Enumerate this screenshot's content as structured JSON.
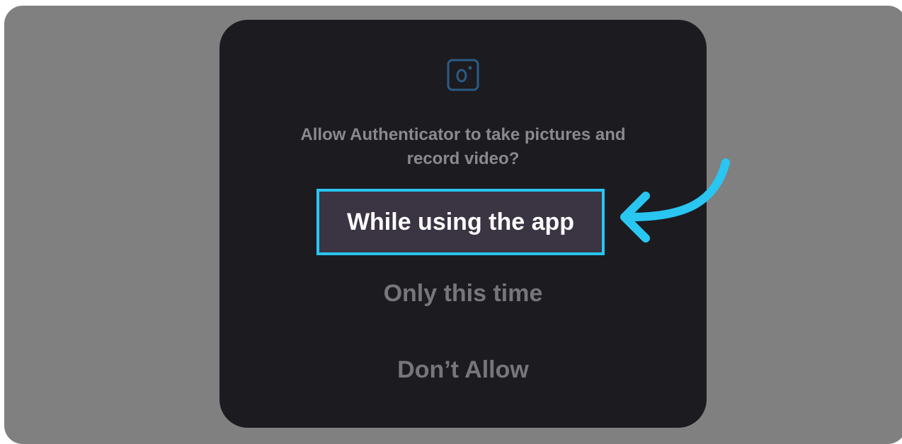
{
  "dialog": {
    "icon": "camera-icon",
    "message_line1": "Allow Authenticator to take pictures and",
    "message_line2": "record video?",
    "options": {
      "while_using": "While using the app",
      "only_this_time": "Only this time",
      "dont_allow": "Don’t Allow"
    }
  },
  "annotation": {
    "icon": "arrow-icon",
    "highlight_color": "#29c6f1"
  },
  "colors": {
    "backdrop": "#808080",
    "dialog_bg": "#1c1b20",
    "highlight_fill": "#3b3443",
    "text_muted": "#77767b",
    "icon_color": "#2a5c86"
  }
}
